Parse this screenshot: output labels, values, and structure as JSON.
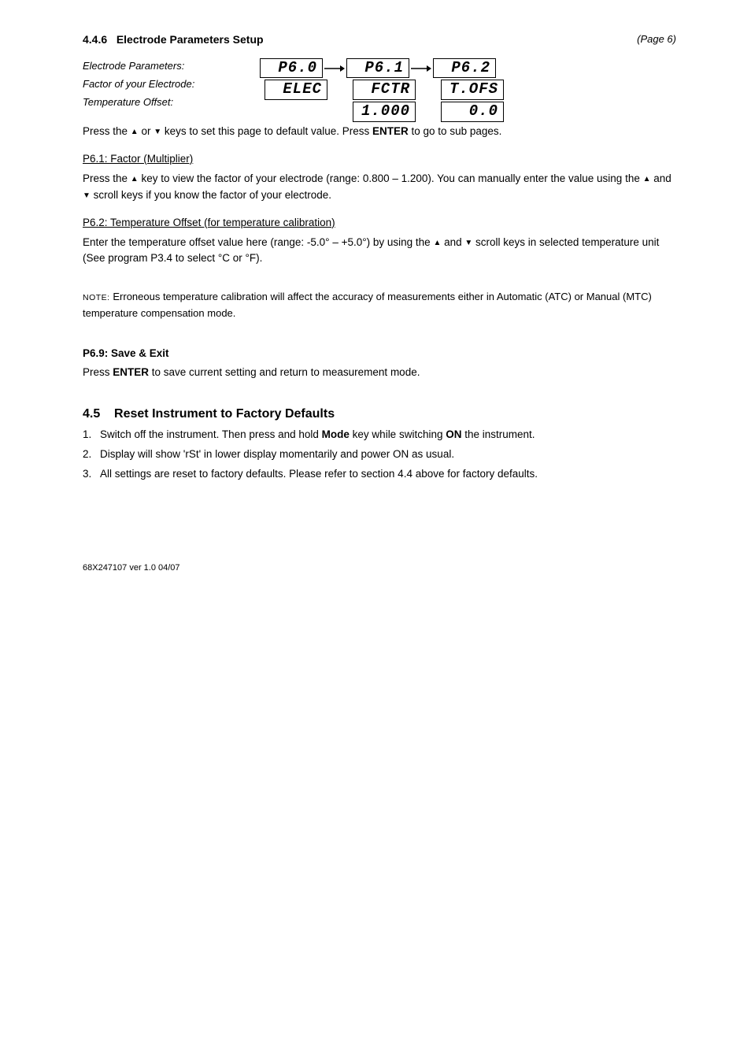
{
  "header": {
    "section_num": "4.4.6",
    "section_title": "Electrode Parameters Setup",
    "page_ref": "(Page 6)"
  },
  "diagram": {
    "labels": {
      "electrode": "Electrode Parameters:",
      "factor": "Factor of your Electrode:",
      "offset": "Temperature Offset:"
    },
    "boxes": {
      "p60": "P6.0",
      "p61": "P6.1",
      "p62": "P6.2",
      "elec": "ELEC",
      "fctr": "FCTR",
      "tofs": "T.OFS",
      "val_fctr": "1.000",
      "val_tofs": "0.0"
    }
  },
  "body": {
    "p1_prefix": "Press the ",
    "p1_mid1": " or ",
    "p1_mid2": " keys to set this page to default value. Press ",
    "p1_bold": "ENTER",
    "p1_suffix": " to go to sub pages.",
    "factor_title": "P6.1: Factor (Multiplier)",
    "p2_prefix": "Press the ",
    "p2_suffix": " key to view the factor of your electrode (range: 0.800 – 1.200). You can manually enter the value using the ",
    "p2_mid": " and ",
    "p2_end": " scroll keys if you know the factor of your electrode.",
    "offset_title": "P6.2: Temperature Offset (for temperature calibration)",
    "p3_prefix": "Enter the temperature offset value here (range: -5.0° – +5.0°) by using the ",
    "p3_mid": " and ",
    "p3_end": " scroll keys in selected temperature unit (See program P3.4 to select ",
    "p3_tail": " or °F).",
    "note_label": "NOTE:",
    "note_text": " Erroneous temperature calibration will affect the accuracy of measurements either in Automatic (ATC) or Manual (MTC) temperature compensation mode.",
    "save_title": "P6.9: Save & Exit",
    "save_prefix": "Press ",
    "save_bold": "ENTER",
    "save_suffix": " to save current setting and return to measurement mode.",
    "reset_section": "4.5",
    "reset_title": "Reset Instrument to Factory Defaults",
    "step1_num": "1.",
    "step1_text_a": "Switch off the instrument. Then press and hold ",
    "step1_bold1": "Mode",
    "step1_mid": " key while switching ",
    "step1_bold2": "ON",
    "step1_tail": " the instrument.",
    "step2_num": "2.",
    "step2_text": "Display will show 'rSt' in lower display momentarily and power ON as usual.",
    "step3_num": "3.",
    "step3_text": "All settings are reset to factory defaults. Please refer to section 4.4 above for factory defaults."
  },
  "footer": {
    "text": "68X247107 ver 1.0 04/07"
  }
}
